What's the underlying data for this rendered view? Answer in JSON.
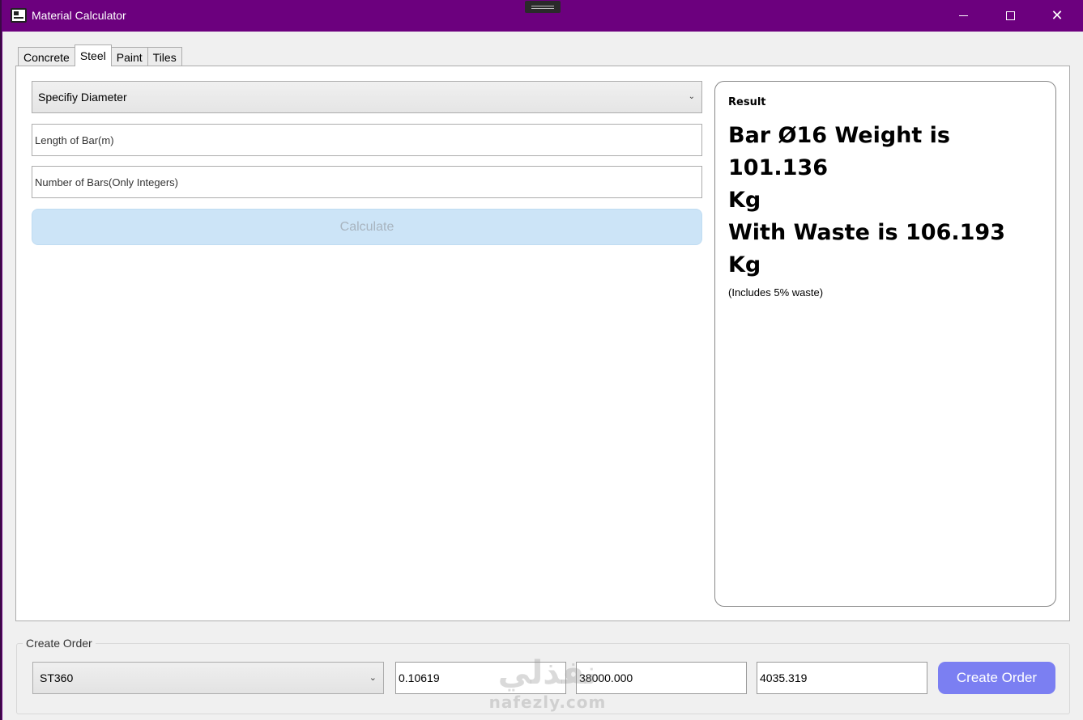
{
  "window": {
    "title": "Material Calculator",
    "controls": {
      "minimize": "minimize",
      "maximize": "maximize",
      "close": "✕"
    }
  },
  "tabs": [
    {
      "label": "Concrete",
      "active": false
    },
    {
      "label": "Steel",
      "active": true
    },
    {
      "label": "Paint",
      "active": false
    },
    {
      "label": "Tiles",
      "active": false
    }
  ],
  "steel": {
    "diameter_select": "Specifiy Diameter",
    "length_placeholder": "Length of Bar(m)",
    "count_placeholder": "Number of Bars(Only Integers)",
    "calculate_label": "Calculate",
    "result": {
      "label": "Result",
      "line1": "Bar Ø16 Weight is 101.136",
      "line2": "Kg",
      "line3": "With Waste is 106.193 Kg",
      "note": "(Includes 5% waste)"
    }
  },
  "order": {
    "legend": "Create Order",
    "material": "ST360",
    "field1": "0.10619",
    "field2": "38000.000",
    "field3": "4035.319",
    "button": "Create Order"
  },
  "watermark": {
    "logo": "نفذلي",
    "text": "nafezly.com"
  },
  "colors": {
    "titlebar": "#6c007e",
    "calculate_disabled": "#cce4f7",
    "order_button": "#7b7ff2"
  }
}
